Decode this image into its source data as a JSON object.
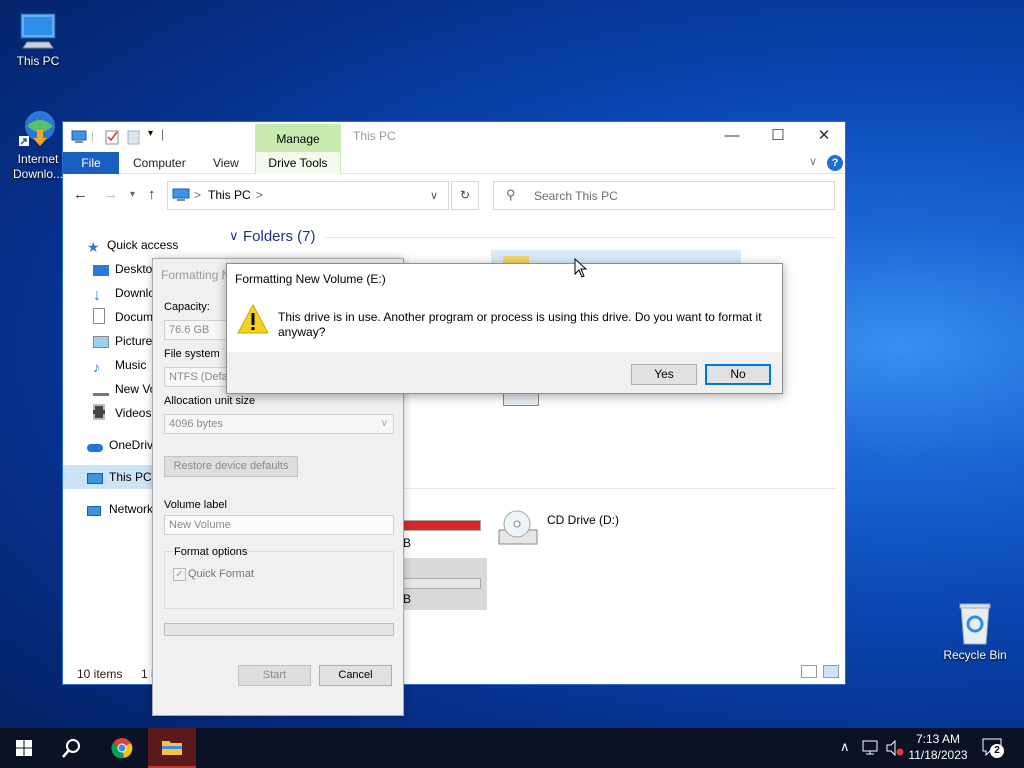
{
  "desktop": {
    "icons": [
      {
        "label": "This PC"
      },
      {
        "label": "Internet Downlo..."
      },
      {
        "label": "Recycle Bin"
      }
    ]
  },
  "explorer": {
    "title": "This PC",
    "manage_tab": "Manage",
    "ribbon_tabs": {
      "file": "File",
      "computer": "Computer",
      "view": "View",
      "drive_tools": "Drive Tools"
    },
    "address": {
      "path": "This PC",
      "separator": ">"
    },
    "search_placeholder": "Search This PC",
    "folders_header": "Folders (7)",
    "nav": {
      "quick_access": "Quick access",
      "desktop": "Desktop",
      "downloads": "Downlo",
      "documents": "Docum",
      "pictures": "Picture",
      "music": "Music",
      "new_volume": "New Vo",
      "videos": "Videos",
      "onedrive": "OneDrive",
      "this_pc": "This PC",
      "network": "Network"
    },
    "devices": {
      "cd_drive": "CD Drive (D:)",
      "drive_c_free_suffix": "B",
      "drive_e_free_suffix": "B",
      "drive_c_usage": 0.93
    },
    "status": {
      "items": "10 items",
      "selected": "1 i"
    }
  },
  "format_dialog": {
    "title": "Formatting N",
    "capacity_label": "Capacity:",
    "capacity_value": "76.6 GB",
    "filesystem_label": "File system",
    "filesystem_value": "NTFS (Defa",
    "alloc_label": "Allocation unit size",
    "alloc_value": "4096 bytes",
    "restore_button": "Restore device defaults",
    "volume_label_label": "Volume label",
    "volume_label_value": "New Volume",
    "format_options_label": "Format options",
    "quick_format_label": "Quick Format",
    "start_button": "Start",
    "cancel_button": "Cancel"
  },
  "message_box": {
    "title": "Formatting New Volume (E:)",
    "text": "This drive is in use. Another program or process is using this drive. Do you want to format it anyway?",
    "yes_button": "Yes",
    "no_button": "No"
  },
  "taskbar": {
    "time": "7:13 AM",
    "date": "11/18/2023",
    "notification_count": "2"
  },
  "colors": {
    "accent": "#0078d7",
    "file_tab": "#1a5fbe",
    "manage_tab": "#c8ecb0",
    "drive_bar_full": "#da2626",
    "taskbar": "#0b1224"
  }
}
